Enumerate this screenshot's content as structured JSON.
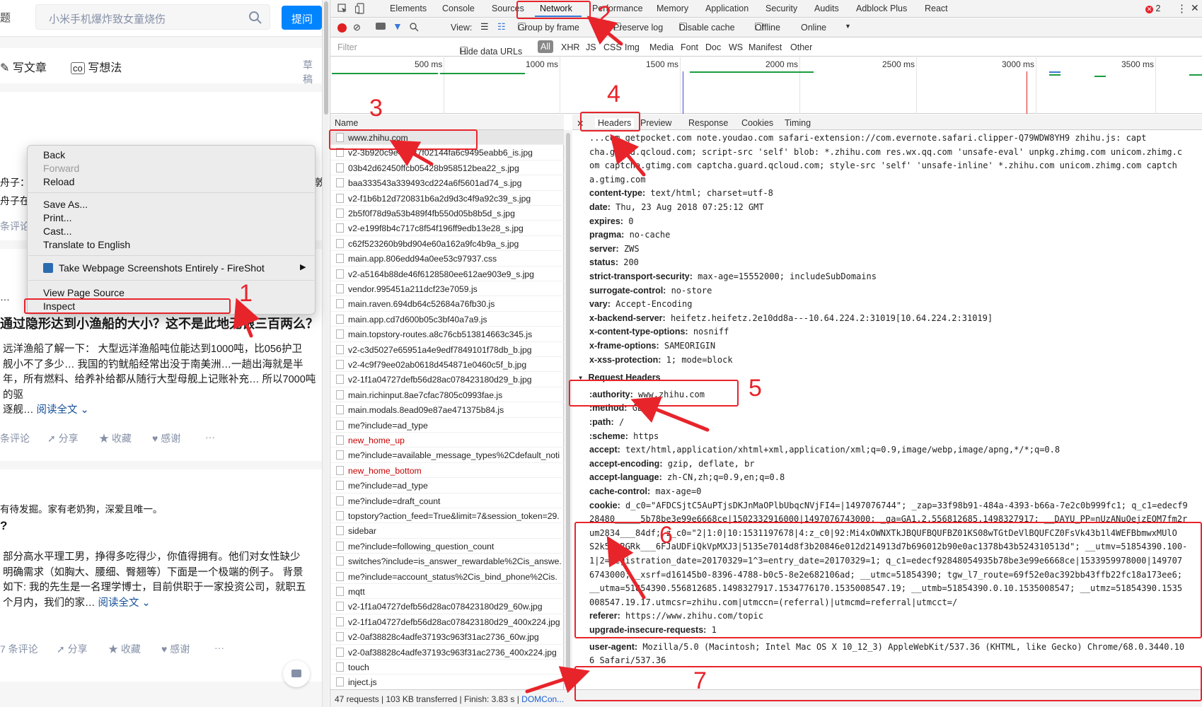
{
  "left_page": {
    "ask_partial": "题",
    "search_placeholder": "小米手机爆炸致女童烧伤",
    "ask_button": "提问",
    "write_article": "写文章",
    "write_idea": "写想法",
    "draft": "草稿",
    "card1_line1": "舟子：",
    "card1_line1_tail": "敦",
    "card1_line2": "舟子在",
    "card1_comments": "条评论",
    "card2_dots": "…",
    "card2_title": "通过隐形达到小渔船的大小？这不是此地无银三百两么？",
    "card2_body": [
      "远洋渔船了解一下： 大型远洋渔船吨位能达到1000吨，比056护卫",
      "舰小不了多少… 我国的钓鱿船经常出没于南美洲…一趟出海就是半",
      "年，所有燃料、给养补给都从随行大型母舰上记账补充… 所以7000吨的驱",
      "逐舰…"
    ],
    "read_more": "阅读全文",
    "card2_actions": {
      "comments": "条评论",
      "share": "分享",
      "fav": "收藏",
      "thanks": "感谢",
      "more": "···"
    },
    "card3_intro": "有待发掘。家有老奶狗，深爱且唯一。",
    "card3_q": "?",
    "card3_body": [
      "部分高水平理工男，挣得多吃得少，你值得拥有。他们对女性缺少",
      "明确需求（如胸大、腰细、臀翘等）下面是一个极端的例子。 背景",
      "如下: 我的先生是一名理学博士，目前供职于一家投资公司，就职五",
      "个月内，我们的家…"
    ],
    "card3_actions": {
      "comments": "7 条评论",
      "share": "分享",
      "fav": "收藏",
      "thanks": "感谢",
      "more": "···"
    }
  },
  "context_menu": {
    "items": [
      "Back",
      "Forward",
      "Reload",
      "Save As...",
      "Print...",
      "Cast...",
      "Translate to English",
      "Take Webpage Screenshots Entirely - FireShot",
      "View Page Source",
      "Inspect"
    ],
    "disabled": "Forward"
  },
  "devtools": {
    "tabs": [
      "Elements",
      "Console",
      "Sources",
      "Network",
      "Performance",
      "Memory",
      "Application",
      "Security",
      "Audits",
      "Adblock Plus",
      "React"
    ],
    "active_tab": "Network",
    "error_count": "2",
    "toolbar": {
      "view": "View:",
      "group_by_frame": "Group by frame",
      "preserve_log": "Preserve log",
      "disable_cache": "Disable cache",
      "offline": "Offline",
      "online": "Online"
    },
    "filter": {
      "placeholder": "Filter",
      "hide_data_urls": "Hide data URLs",
      "types": [
        "All",
        "XHR",
        "JS",
        "CSS",
        "Img",
        "Media",
        "Font",
        "Doc",
        "WS",
        "Manifest",
        "Other"
      ]
    },
    "timeline_labels": [
      "500 ms",
      "1000 ms",
      "1500 ms",
      "2000 ms",
      "2500 ms",
      "3000 ms",
      "3500 ms"
    ],
    "names_header": "Name",
    "requests": [
      "www.zhihu.com",
      "v2-3b920c9e46b37f02144fa6c9495eabb6_is.jpg",
      "03b42d62450ffcb05428b958512bea22_s.jpg",
      "baa333543a339493cd224a6f5601ad74_s.jpg",
      "v2-f1b6b12d720831b6a2d9d3c4f9a92c39_s.jpg",
      "2b5f0f78d9a53b489f4fb550d05b8b5d_s.jpg",
      "v2-e199f8b4c717c8f54f196ff9edb13e28_s.jpg",
      "c62f523260b9bd904e60a162a9fc4b9a_s.jpg",
      "main.app.806edd94a0ee53c97937.css",
      "v2-a5164b88de46f6128580ee612ae903e9_s.jpg",
      "vendor.995451a211dcf23e7059.js",
      "main.raven.694db64c52684a76fb30.js",
      "main.app.cd7d600b05c3bf40a7a9.js",
      "main.topstory-routes.a8c76cb513814663c345.js",
      "v2-c3d5027e65951a4e9edf7849101f78db_b.jpg",
      "v2-4c9f79ee02ab0618d454871e0460c5f_b.jpg",
      "v2-1f1a04727defb56d28ac078423180d29_b.jpg",
      "main.richinput.8ae7cfac7805c0993fae.js",
      "main.modals.8ead09e87ae471375b84.js",
      "me?include=ad_type",
      "new_home_up",
      "me?include=available_message_types%2Cdefault_noti",
      "new_home_bottom",
      "me?include=ad_type",
      "me?include=draft_count",
      "topstory?action_feed=True&limit=7&session_token=29.",
      "sidebar",
      "me?include=following_question_count",
      "switches?include=is_answer_rewardable%2Cis_answe.",
      "me?include=account_status%2Cis_bind_phone%2Cis.",
      "mqtt",
      "v2-1f1a04727defb56d28ac078423180d29_60w.jpg",
      "v2-1f1a04727defb56d28ac078423180d29_400x224.jpg",
      "v2-0af38828c4adfe37193c963f31ac2736_60w.jpg",
      "v2-0af38828c4adfe37193c963f31ac2736_400x224.jpg",
      "touch",
      "inject.js"
    ],
    "red_requests": [
      "new_home_up",
      "new_home_bottom"
    ],
    "detail_tabs": [
      "Headers",
      "Preview",
      "Response",
      "Cookies",
      "Timing"
    ],
    "csp_lines": [
      "...com getpocket.com note.youdao.com safari-extension://com.evernote.safari.clipper-Q79WDW8YH9 zhihu.js: capt",
      "cha.guard.qcloud.com; script-src 'self' blob: *.zhihu.com res.wx.qq.com 'unsafe-eval' unpkg.zhimg.com unicom.zhimg.c",
      "om captcha.gtimg.com captcha.guard.qcloud.com; style-src 'self' 'unsafe-inline' *.zhihu.com unicom.zhimg.com captch",
      "a.gtimg.com"
    ],
    "response_headers": [
      {
        "k": "content-type:",
        "v": "text/html; charset=utf-8"
      },
      {
        "k": "date:",
        "v": "Thu, 23 Aug 2018 07:25:12 GMT"
      },
      {
        "k": "expires:",
        "v": "0"
      },
      {
        "k": "pragma:",
        "v": "no-cache"
      },
      {
        "k": "server:",
        "v": "ZWS"
      },
      {
        "k": "status:",
        "v": "200"
      },
      {
        "k": "strict-transport-security:",
        "v": "max-age=15552000; includeSubDomains"
      },
      {
        "k": "surrogate-control:",
        "v": "no-store"
      },
      {
        "k": "vary:",
        "v": "Accept-Encoding"
      },
      {
        "k": "x-backend-server:",
        "v": "heifetz.heifetz.2e10dd8a---10.64.224.2:31019[10.64.224.2:31019]"
      },
      {
        "k": "x-content-type-options:",
        "v": "nosniff"
      },
      {
        "k": "x-frame-options:",
        "v": "SAMEORIGIN"
      },
      {
        "k": "x-xss-protection:",
        "v": "1; mode=block"
      }
    ],
    "request_headers_title": "Request Headers",
    "request_headers": [
      {
        "k": ":authority:",
        "v": "www.zhihu.com"
      },
      {
        "k": ":method:",
        "v": "GET"
      },
      {
        "k": ":path:",
        "v": "/"
      },
      {
        "k": ":scheme:",
        "v": "https"
      },
      {
        "k": "accept:",
        "v": "text/html,application/xhtml+xml,application/xml;q=0.9,image/webp,image/apng,*/*;q=0.8"
      },
      {
        "k": "accept-encoding:",
        "v": "gzip, deflate, br"
      },
      {
        "k": "accept-language:",
        "v": "zh-CN,zh;q=0.9,en;q=0.8"
      },
      {
        "k": "cache-control:",
        "v": "max-age=0"
      }
    ],
    "cookie_key": "cookie:",
    "cookie_lines": [
      "d_c0=\"AFDCSjtC5AuPTjsDKJnMaOPlbUbqcNVjFI4=|1497076744\"; _zap=33f98b91-484a-4393-b66a-7e2c0b999fc1; q_c1=edecf9",
      "28480_____5b78be3e99e6668ce|1502332916000|1497076743000; _ga=GA1.2.556812685.1498327917; __DAYU_PP=nUzANuQejzEQM7fm2r",
      "um2834___84df; z_c0=\"2|1:0|10:1531197678|4:z_c0|92:Mi4xOWNXTkJBQUFBQUFBZ01KS08wTGtDeVlBQUFCZ0FsVk43b1l4WEFBbmwxMUlO",
      "S2k5N3RGRk___6FJaUDFiQkVpMXJ3|5135e7014d8f3b20846e012d214913d7b696012b90e0ac1378b43b524310513d\"; __utmv=51854390.100-",
      "1|2=registration_date=20170329=1^3=entry_date=20170329=1; q_c1=edecf92848054935b78be3e99e6668ce|1533959978000|149707",
      "6743000; _xsrf=d16145b0-8396-4788-b0c5-8e2e682106ad; __utmc=51854390; tgw_l7_route=69f52e0ac392bb43ffb22fc18a173ee6;",
      "__utma=51854390.556812685.1498327917.1534776170.1535008547.19; __utmb=51854390.0.10.1535008547; __utmz=51854390.1535",
      "008547.19.17.utmcsr=zhihu.com|utmccn=(referral)|utmcmd=referral|utmcct=/"
    ],
    "referer": {
      "k": "referer:",
      "v": "https://www.zhihu.com/topic"
    },
    "upgrade": {
      "k": "upgrade-insecure-requests:",
      "v": "1"
    },
    "ua_key": "user-agent:",
    "ua_lines": [
      "Mozilla/5.0 (Macintosh; Intel Mac OS X 10_12_3) AppleWebKit/537.36 (KHTML, like Gecko) Chrome/68.0.3440.10",
      "6 Safari/537.36"
    ],
    "status": "47 requests | 103 KB transferred | Finish: 3.83 s |",
    "status_link": "DOMCon..."
  },
  "annotations": [
    "1",
    "2",
    "3",
    "4",
    "5",
    "6",
    "7"
  ],
  "colors": {
    "accent": "#0084ff",
    "annotation": "#e8242b",
    "devtools_blue": "#3879d9",
    "link": "#175199"
  }
}
